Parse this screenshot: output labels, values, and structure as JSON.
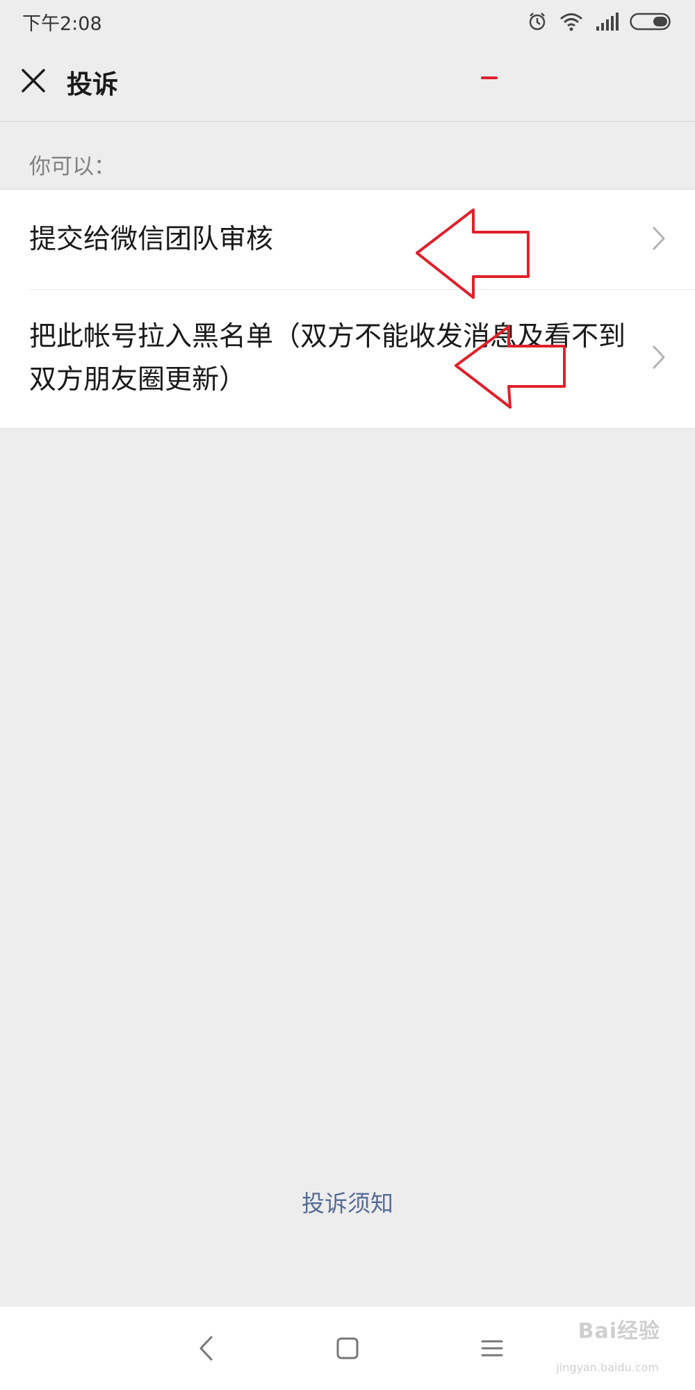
{
  "status_bar": {
    "time": "下午2:08",
    "icons": [
      "alarm-icon",
      "wifi-icon",
      "signal-icon",
      "battery-icon"
    ]
  },
  "nav": {
    "title": "投诉",
    "close_icon": "close-icon"
  },
  "section": {
    "label": "你可以："
  },
  "options": [
    {
      "label": "提交给微信团队审核",
      "icon": "chevron-right-icon"
    },
    {
      "label": "把此帐号拉入黑名单（双方不能收发消息及看不到双方朋友圈更新）",
      "icon": "chevron-right-icon"
    }
  ],
  "footer": {
    "notice_link": "投诉须知"
  },
  "system_nav": {
    "icons": [
      "back-icon",
      "home-icon",
      "menu-icon"
    ]
  },
  "watermark": {
    "text": "Bai经验",
    "sub": "jingyan.baidu.com"
  },
  "colors": {
    "background": "#ededed",
    "card": "#ffffff",
    "link": "#576b95",
    "annotation": "#e0202a"
  }
}
